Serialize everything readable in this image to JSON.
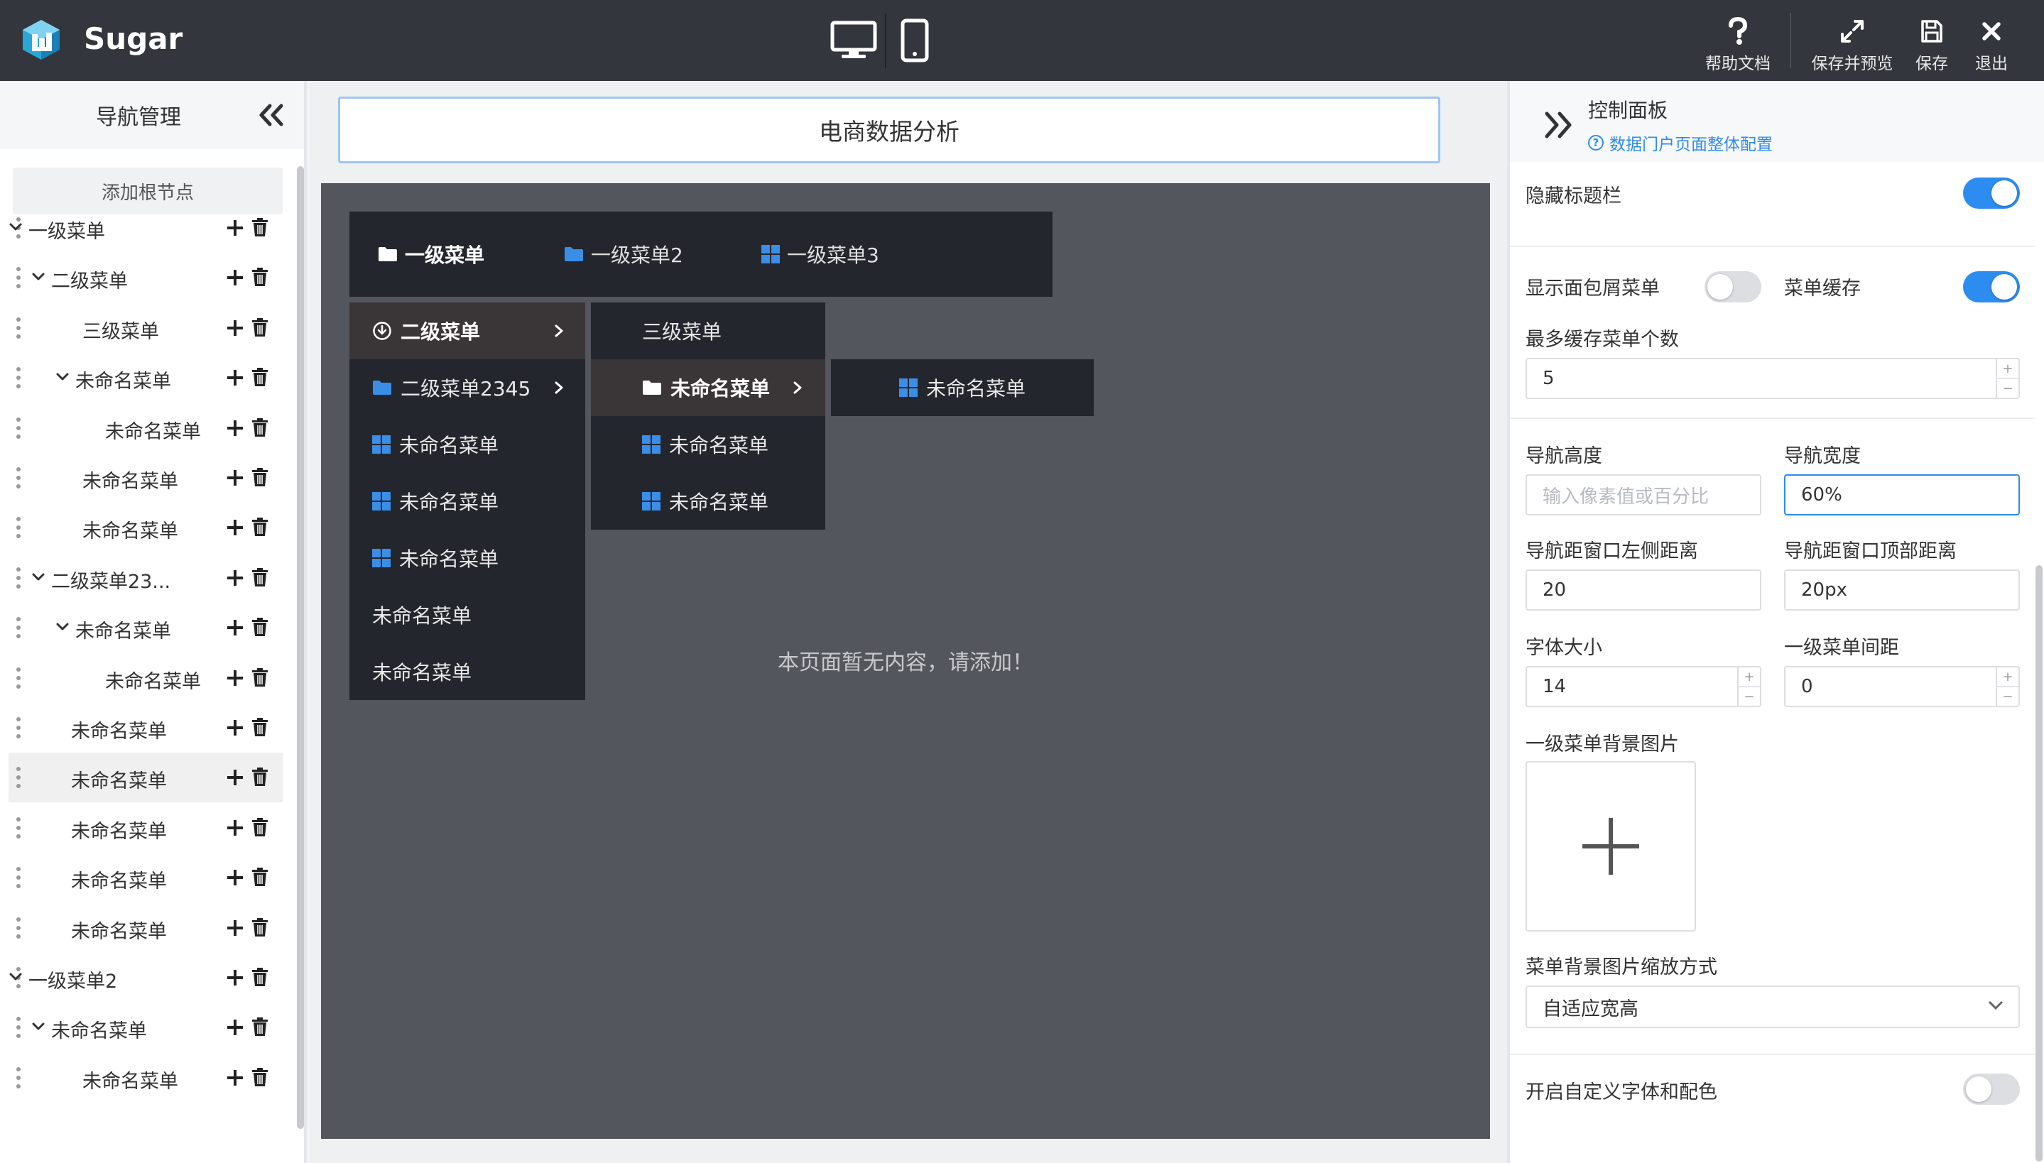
{
  "app": {
    "name": "Sugar"
  },
  "header": {
    "actions": [
      {
        "label": "帮助文档",
        "icon": "help-icon"
      },
      {
        "label": "保存并预览",
        "icon": "expand-icon"
      },
      {
        "label": "保存",
        "icon": "save-icon"
      },
      {
        "label": "退出",
        "icon": "close-icon"
      }
    ],
    "devices": [
      "desktop-icon",
      "mobile-icon"
    ]
  },
  "sidebar": {
    "title": "导航管理",
    "add_root": "添加根节点",
    "tree": [
      {
        "label": "一级菜单",
        "level": 0,
        "caret": true
      },
      {
        "label": "二级菜单",
        "level": 1,
        "caret": true
      },
      {
        "label": "三级菜单",
        "level": 2,
        "caret": false
      },
      {
        "label": "未命名菜单",
        "level": 2,
        "caret": true
      },
      {
        "label": "未命名菜单",
        "level": 3,
        "caret": false
      },
      {
        "label": "未命名菜单",
        "level": 2,
        "caret": false
      },
      {
        "label": "未命名菜单",
        "level": 2,
        "caret": false
      },
      {
        "label": "二级菜单23...",
        "level": 1,
        "caret": true
      },
      {
        "label": "未命名菜单",
        "level": 2,
        "caret": true
      },
      {
        "label": "未命名菜单",
        "level": 3,
        "caret": false
      },
      {
        "label": "未命名菜单",
        "level": 1,
        "caret": false
      },
      {
        "label": "未命名菜单",
        "level": 1,
        "caret": false,
        "active": true
      },
      {
        "label": "未命名菜单",
        "level": 1,
        "caret": false
      },
      {
        "label": "未命名菜单",
        "level": 1,
        "caret": false
      },
      {
        "label": "未命名菜单",
        "level": 1,
        "caret": false
      },
      {
        "label": "一级菜单2",
        "level": 0,
        "caret": true
      },
      {
        "label": "未命名菜单",
        "level": 1,
        "caret": true
      },
      {
        "label": "未命名菜单",
        "level": 2,
        "caret": false
      }
    ]
  },
  "canvas": {
    "page_title": "电商数据分析",
    "empty_message": "本页面暂无内容，请添加！",
    "menu_bar": [
      {
        "label": "一级菜单",
        "icon": "folder-icon",
        "active": true
      },
      {
        "label": "一级菜单2",
        "icon": "folder-icon",
        "active": false
      },
      {
        "label": "一级菜单3",
        "icon": "grid-icon",
        "active": false
      }
    ],
    "submenu_level2": [
      {
        "label": "二级菜单",
        "icon": "download-circle-icon",
        "arrow": true,
        "highlight": true
      },
      {
        "label": "二级菜单2345",
        "icon": "folder-icon",
        "arrow": true,
        "highlight": false
      },
      {
        "label": "未命名菜单",
        "icon": "grid-icon",
        "arrow": false,
        "highlight": false
      },
      {
        "label": "未命名菜单",
        "icon": "grid-icon",
        "arrow": false,
        "highlight": false
      },
      {
        "label": "未命名菜单",
        "icon": "grid-icon",
        "arrow": false,
        "highlight": false
      },
      {
        "label": "未命名菜单",
        "icon": "",
        "arrow": false,
        "highlight": false
      },
      {
        "label": "未命名菜单",
        "icon": "",
        "arrow": false,
        "highlight": false
      }
    ],
    "submenu_level3": [
      {
        "label": "三级菜单",
        "icon": "",
        "arrow": false,
        "highlight": false
      },
      {
        "label": "未命名菜单",
        "icon": "folder-icon",
        "arrow": true,
        "highlight": true
      },
      {
        "label": "未命名菜单",
        "icon": "grid-icon",
        "arrow": false,
        "highlight": false
      },
      {
        "label": "未命名菜单",
        "icon": "grid-icon",
        "arrow": false,
        "highlight": false
      }
    ],
    "submenu_level4": [
      {
        "label": "未命名菜单",
        "icon": "grid-icon"
      }
    ]
  },
  "panel": {
    "title": "控制面板",
    "link": "数据门户页面整体配置",
    "hide_title_bar": {
      "label": "隐藏标题栏",
      "on": true
    },
    "show_breadcrumb": {
      "label": "显示面包屑菜单",
      "on": false
    },
    "menu_cache": {
      "label": "菜单缓存",
      "on": true
    },
    "max_cache": {
      "label": "最多缓存菜单个数",
      "value": "5"
    },
    "nav_height": {
      "label": "导航高度",
      "placeholder": "输入像素值或百分比",
      "value": ""
    },
    "nav_width": {
      "label": "导航宽度",
      "value": "60%"
    },
    "nav_left": {
      "label": "导航距窗口左侧距离",
      "value": "20"
    },
    "nav_top": {
      "label": "导航距窗口顶部距离",
      "value": "20px"
    },
    "font_size": {
      "label": "字体大小",
      "value": "14"
    },
    "menu_gap": {
      "label": "一级菜单间距",
      "value": "0"
    },
    "bg_image": {
      "label": "一级菜单背景图片"
    },
    "bg_fit": {
      "label": "菜单背景图片缩放方式",
      "value": "自适应宽高"
    },
    "custom_font": {
      "label": "开启自定义字体和配色",
      "on": false
    }
  },
  "colors": {
    "accent": "#2d8cf0",
    "header": "#33363c",
    "menu_dark": "#23262d",
    "preview_bg": "#53565d"
  }
}
